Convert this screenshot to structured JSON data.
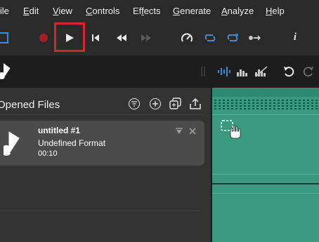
{
  "menu": [
    {
      "label": "ile",
      "underline": "",
      "rest": "ile"
    },
    {
      "label": "Edit",
      "underline": "E",
      "rest": "dit"
    },
    {
      "label": "View",
      "underline": "V",
      "rest": "iew"
    },
    {
      "label": "Controls",
      "underline": "C",
      "rest": "ontrols"
    },
    {
      "label": "Effects",
      "underline": "f",
      "rest": "ects"
    },
    {
      "label": "Generate",
      "underline": "G",
      "rest": "enerate"
    },
    {
      "label": "Analyze",
      "underline": "A",
      "rest": "nalyze"
    },
    {
      "label": "Help",
      "underline": "H",
      "rest": "elp"
    }
  ],
  "toolbar": {
    "icons": [
      "selection-icon",
      "record-icon",
      "play-icon",
      "skip-to-start-icon",
      "rewind-icon",
      "fast-forward-icon",
      "speed-icon",
      "loop-icon",
      "loop-one-icon",
      "next-marker-icon",
      "info-icon"
    ],
    "info_label": "i",
    "highlight_color": "#d6262f"
  },
  "subbar": {
    "icons": [
      "music-note-icon",
      "waveform-icon",
      "spectrum-icon",
      "mute-spectrum-icon",
      "undo-icon",
      "redo-icon"
    ],
    "accent": "#3d8bd8"
  },
  "panel": {
    "title": "Opened Files",
    "actions": [
      "filter-icon",
      "add-icon",
      "duplicate-icon",
      "share-icon"
    ]
  },
  "file": {
    "title": "untitled #1",
    "format": "Undefined Format",
    "duration": "00:10"
  },
  "colors": {
    "track_bg": "#3a9a80",
    "panel_bg": "#333333",
    "card_bg": "#4b4b4b"
  }
}
